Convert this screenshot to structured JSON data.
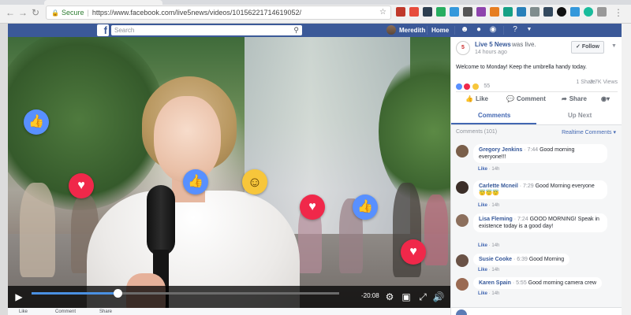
{
  "browser": {
    "secure_label": "Secure",
    "url": "https://www.facebook.com/live5news/videos/10156221714619052/",
    "back_icon": "arrow-left-icon",
    "forward_icon": "arrow-right-icon",
    "reload_icon": "reload-icon",
    "bookmark_icon": "star-icon"
  },
  "fb_header": {
    "logo": "f",
    "search_placeholder": "Search",
    "user_name": "Meredith",
    "home_label": "Home"
  },
  "video": {
    "progress_fraction": 0.28,
    "time_remaining": "-20:08"
  },
  "under_video": {
    "like_label": "Like",
    "comment_label": "Comment",
    "share_label": "Share"
  },
  "post": {
    "page_name": "Live 5 News",
    "status": "was live.",
    "time": "14 hours ago",
    "follow_label": "Follow",
    "text": "Welcome to Monday! Keep the umbrella handy today.",
    "reaction_count": "55",
    "shares": "1 Share",
    "views": "3.7K Views",
    "actions": {
      "like": "Like",
      "comment": "Comment",
      "share": "Share"
    }
  },
  "tabs": {
    "comments": "Comments",
    "up_next": "Up Next"
  },
  "comments_header": {
    "count": "Comments (101)",
    "sort": "Realtime Comments"
  },
  "comments": [
    {
      "name": "Gregory Jenkins",
      "time": "7:44",
      "text": "Good morning everyone!!!",
      "like": "Like",
      "age": "14h"
    },
    {
      "name": "Carlette Mcneil",
      "time": "7:29",
      "text": "Good Morning everyone 😇😇😇",
      "like": "Like",
      "age": "14h"
    },
    {
      "name": "Lisa Fleming",
      "time": "7:24",
      "text": "GOOD MORNING! Speak in existence today is a good day!",
      "like": "Like",
      "age": "14h"
    },
    {
      "name": "Susie Cooke",
      "time": "6:39",
      "text": "Good Morning",
      "like": "Like",
      "age": "14h"
    },
    {
      "name": "Karen Spain",
      "time": "5:55",
      "text": "Good morning camera crew",
      "like": "Like",
      "age": "14h"
    }
  ],
  "colors": {
    "facebook_blue": "#3b5998",
    "link_blue": "#365899",
    "like_blue": "#5890ff",
    "love_red": "#f0284a",
    "progress_blue": "#4a90e2"
  }
}
